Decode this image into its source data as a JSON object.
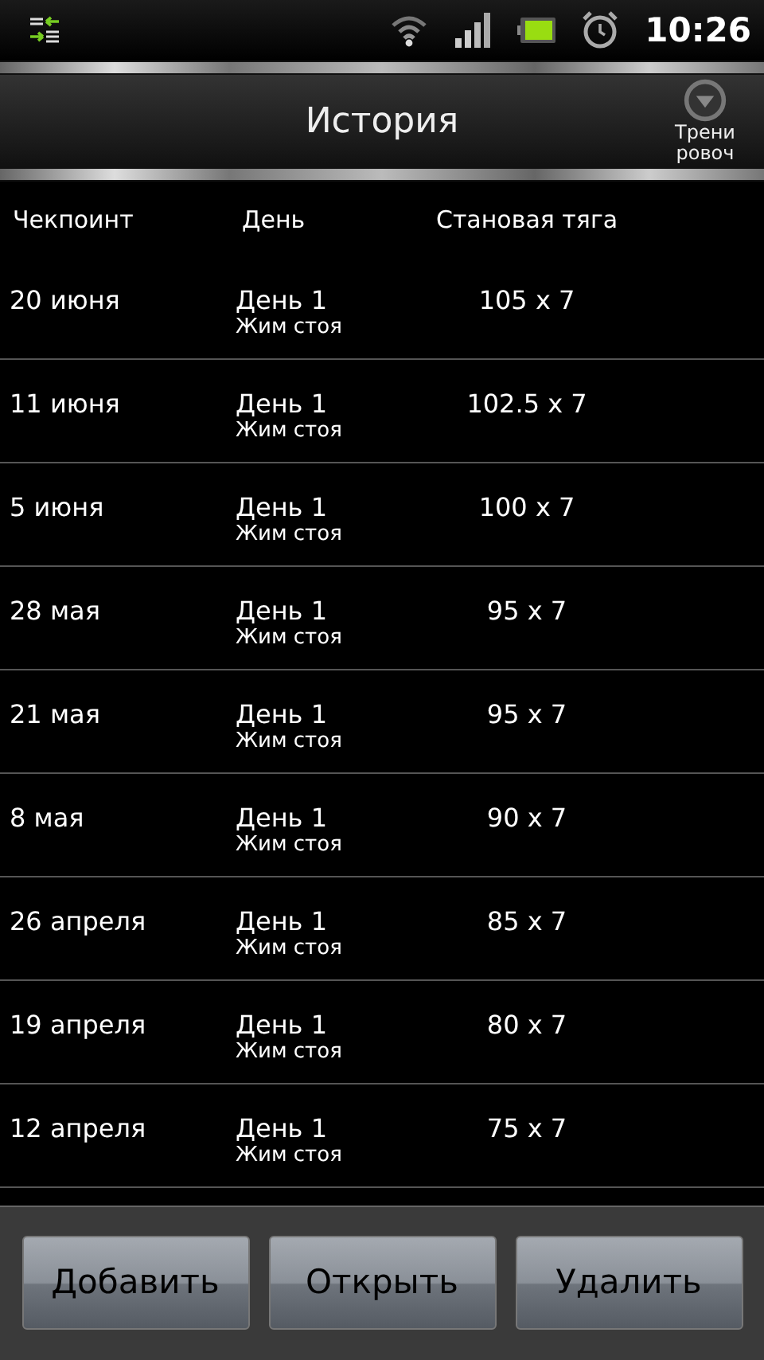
{
  "status_bar": {
    "time": "10:26"
  },
  "title_bar": {
    "title": "История",
    "menu_label": [
      "Трени",
      "ровоч"
    ]
  },
  "table": {
    "columns": [
      "Чекпоинт",
      "День",
      "Становая тяга"
    ],
    "rows": [
      {
        "date": "20 июня",
        "day": "День 1",
        "exercise": "Жим стоя",
        "result": "105 x 7"
      },
      {
        "date": "11 июня",
        "day": "День 1",
        "exercise": "Жим стоя",
        "result": "102.5 x 7"
      },
      {
        "date": "5 июня",
        "day": "День 1",
        "exercise": "Жим стоя",
        "result": "100 x 7"
      },
      {
        "date": "28 мая",
        "day": "День 1",
        "exercise": "Жим стоя",
        "result": "95 x 7"
      },
      {
        "date": "21 мая",
        "day": "День 1",
        "exercise": "Жим стоя",
        "result": "95 x 7"
      },
      {
        "date": "8 мая",
        "day": "День 1",
        "exercise": "Жим стоя",
        "result": "90 x 7"
      },
      {
        "date": "26 апреля",
        "day": "День 1",
        "exercise": "Жим стоя",
        "result": "85 x 7"
      },
      {
        "date": "19 апреля",
        "day": "День 1",
        "exercise": "Жим стоя",
        "result": "80 x 7"
      },
      {
        "date": "12 апреля",
        "day": "День 1",
        "exercise": "Жим стоя",
        "result": "75 x 7"
      }
    ]
  },
  "buttons": [
    "Добавить",
    "Открыть",
    "Удалить"
  ]
}
